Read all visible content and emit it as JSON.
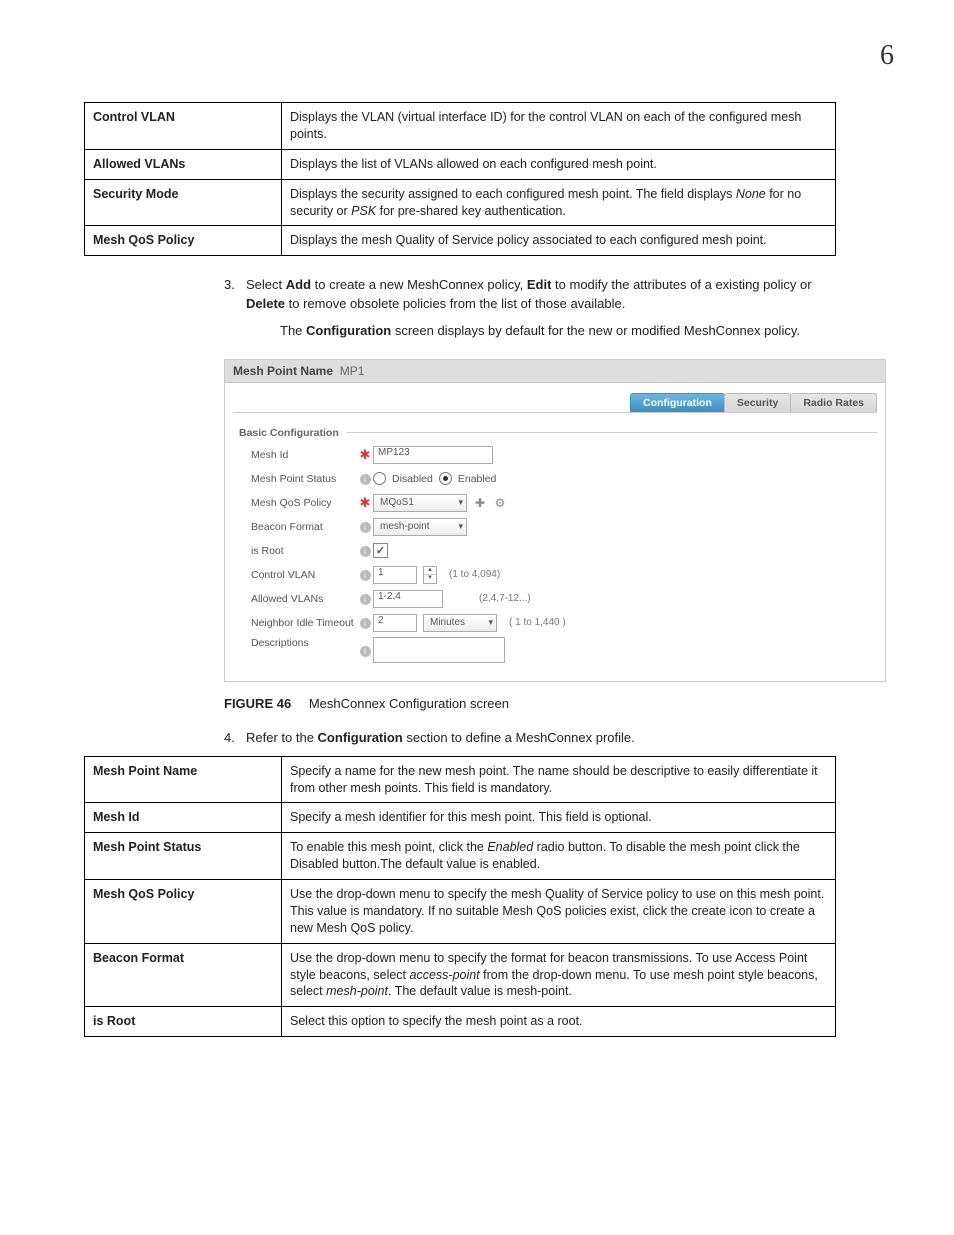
{
  "page_number": "6",
  "table1": {
    "rows": [
      {
        "label": "Control VLAN",
        "desc": "Displays the VLAN (virtual interface ID) for the control VLAN on each of the configured mesh points."
      },
      {
        "label": "Allowed VLANs",
        "desc": "Displays the list of VLANs allowed on each configured mesh point."
      },
      {
        "label": "Security Mode",
        "desc_parts": [
          "Displays the security assigned to each configured mesh point. The field displays ",
          "None",
          " for no security or ",
          "PSK",
          " for pre-shared key authentication."
        ]
      },
      {
        "label": "Mesh QoS Policy",
        "desc": "Displays the mesh Quality of Service policy associated to each configured mesh point."
      }
    ]
  },
  "step3": {
    "num": "3.",
    "parts": [
      "Select ",
      "Add",
      " to create a new MeshConnex policy, ",
      "Edit",
      " to modify the attributes of a existing policy or ",
      "Delete",
      " to remove obsolete policies from the list of those available."
    ]
  },
  "step3_sub": {
    "parts": [
      "The ",
      "Configuration",
      " screen displays by default for the new or modified MeshConnex policy."
    ]
  },
  "screenshot": {
    "title_label": "Mesh Point Name",
    "title_value": "MP1",
    "tabs": {
      "configuration": "Configuration",
      "security": "Security",
      "radio_rates": "Radio Rates"
    },
    "section": "Basic Configuration",
    "rows": {
      "mesh_id": {
        "label": "Mesh Id",
        "value": "MP123"
      },
      "mesh_point_status": {
        "label": "Mesh Point Status",
        "opt_disabled": "Disabled",
        "opt_enabled": "Enabled"
      },
      "mesh_qos_policy": {
        "label": "Mesh QoS Policy",
        "value": "MQoS1"
      },
      "beacon_format": {
        "label": "Beacon Format",
        "value": "mesh-point"
      },
      "is_root": {
        "label": "is Root"
      },
      "control_vlan": {
        "label": "Control VLAN",
        "value": "1",
        "hint": "(1 to 4,094)"
      },
      "allowed_vlans": {
        "label": "Allowed VLANs",
        "value": "1-2,4",
        "hint": "(2,4,7-12...)"
      },
      "neighbor_idle": {
        "label": "Neighbor Idle Timeout",
        "value": "2",
        "unit": "Minutes",
        "hint": "( 1 to 1,440 )"
      },
      "descriptions": {
        "label": "Descriptions"
      }
    }
  },
  "figure": {
    "num": "FIGURE 46",
    "caption": "MeshConnex Configuration screen"
  },
  "step4": {
    "num": "4.",
    "parts": [
      "Refer to the ",
      "Configuration",
      " section to define a MeshConnex profile."
    ]
  },
  "table2": {
    "rows": [
      {
        "label": "Mesh Point Name",
        "desc": "Specify a name for the new mesh point. The name should be descriptive to easily differentiate it from other mesh points. This field is mandatory."
      },
      {
        "label": "Mesh Id",
        "desc": "Specify a mesh identifier for this mesh point. This field is optional."
      },
      {
        "label": "Mesh Point Status",
        "desc_parts": [
          "To enable this mesh point, click the ",
          "Enabled",
          " radio button. To disable the mesh point click the Disabled button.The default value is enabled."
        ]
      },
      {
        "label": "Mesh QoS Policy",
        "desc": "Use the drop-down menu to specify the mesh Quality of Service policy to use on this mesh point. This value is mandatory. If no suitable Mesh QoS policies exist, click the create icon to create a new Mesh QoS policy."
      },
      {
        "label": "Beacon Format",
        "desc_parts": [
          "Use the drop-down menu to specify the format for beacon transmissions. To use Access Point style beacons, select ",
          "access-point",
          " from the drop-down menu. To use mesh point style beacons, select ",
          "mesh-point",
          ". The default value is mesh-point."
        ]
      },
      {
        "label": "is Root",
        "desc": "Select this option to specify the mesh point as a root."
      }
    ]
  }
}
